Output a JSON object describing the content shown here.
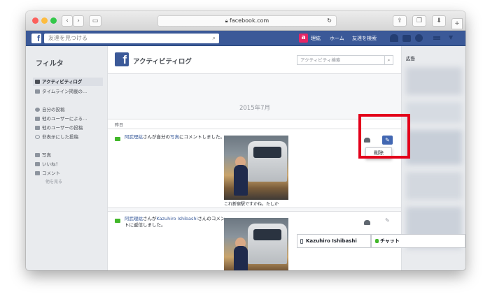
{
  "browser": {
    "url": "facebook.com",
    "back_icon": "chevron-left-icon",
    "forward_icon": "chevron-right-icon",
    "sidebar_icon": "sidebar-icon",
    "reload_icon": "reload-icon",
    "share_icon": "share-icon",
    "tabs_icon": "tabs-icon",
    "download_icon": "download-icon",
    "newtab_icon": "plus-icon"
  },
  "fb_header": {
    "logo": "f",
    "search_placeholder": "友達を見つける",
    "user_name": "理紘",
    "user_avatar_letter": "a",
    "nav_home": "ホーム",
    "nav_find_friends": "友達を検索"
  },
  "sidebar": {
    "title": "フィルタ",
    "items": [
      {
        "label": "アクティビティログ",
        "icon": "log-icon"
      },
      {
        "label": "タイムライン掲載の...",
        "icon": "timeline-icon"
      },
      {
        "label": "自分の投稿",
        "icon": "user-icon"
      },
      {
        "label": "他のユーザーによる...",
        "icon": "tag-icon"
      },
      {
        "label": "他のユーザーの投稿",
        "icon": "comment-icon"
      },
      {
        "label": "非表示にした投稿",
        "icon": "hidden-icon"
      },
      {
        "label": "写真",
        "icon": "photo-icon"
      },
      {
        "label": "いいね！",
        "icon": "like-icon"
      },
      {
        "label": "コメント",
        "icon": "comment-icon"
      },
      {
        "label": "他を見る",
        "icon": ""
      }
    ]
  },
  "main": {
    "title": "アクティビティログ",
    "search_placeholder": "アクティビティ検索",
    "month": "2015年7月",
    "section_label": "昨日",
    "entries": [
      {
        "author": "阿武理紘",
        "text_mid": "さんが自分の",
        "link": "写真",
        "text_end": "にコメントしました。",
        "caption": "これ新宿駅ですかね。たしか"
      },
      {
        "author": "阿武理紘",
        "text_mid": "さんが",
        "link": "Kazuhiro Ishibashi",
        "text_end": "さんのコメントに返信しました。",
        "caption": ""
      }
    ],
    "menu_delete": "削除"
  },
  "right_column": {
    "ads_label": "広告"
  },
  "chat": {
    "contact_name": "Kazuhiro Ishibashi",
    "chat_label": "チャット"
  },
  "colors": {
    "fb_blue": "#3b5998",
    "highlight_red": "#e3001b",
    "link_blue": "#365899"
  }
}
